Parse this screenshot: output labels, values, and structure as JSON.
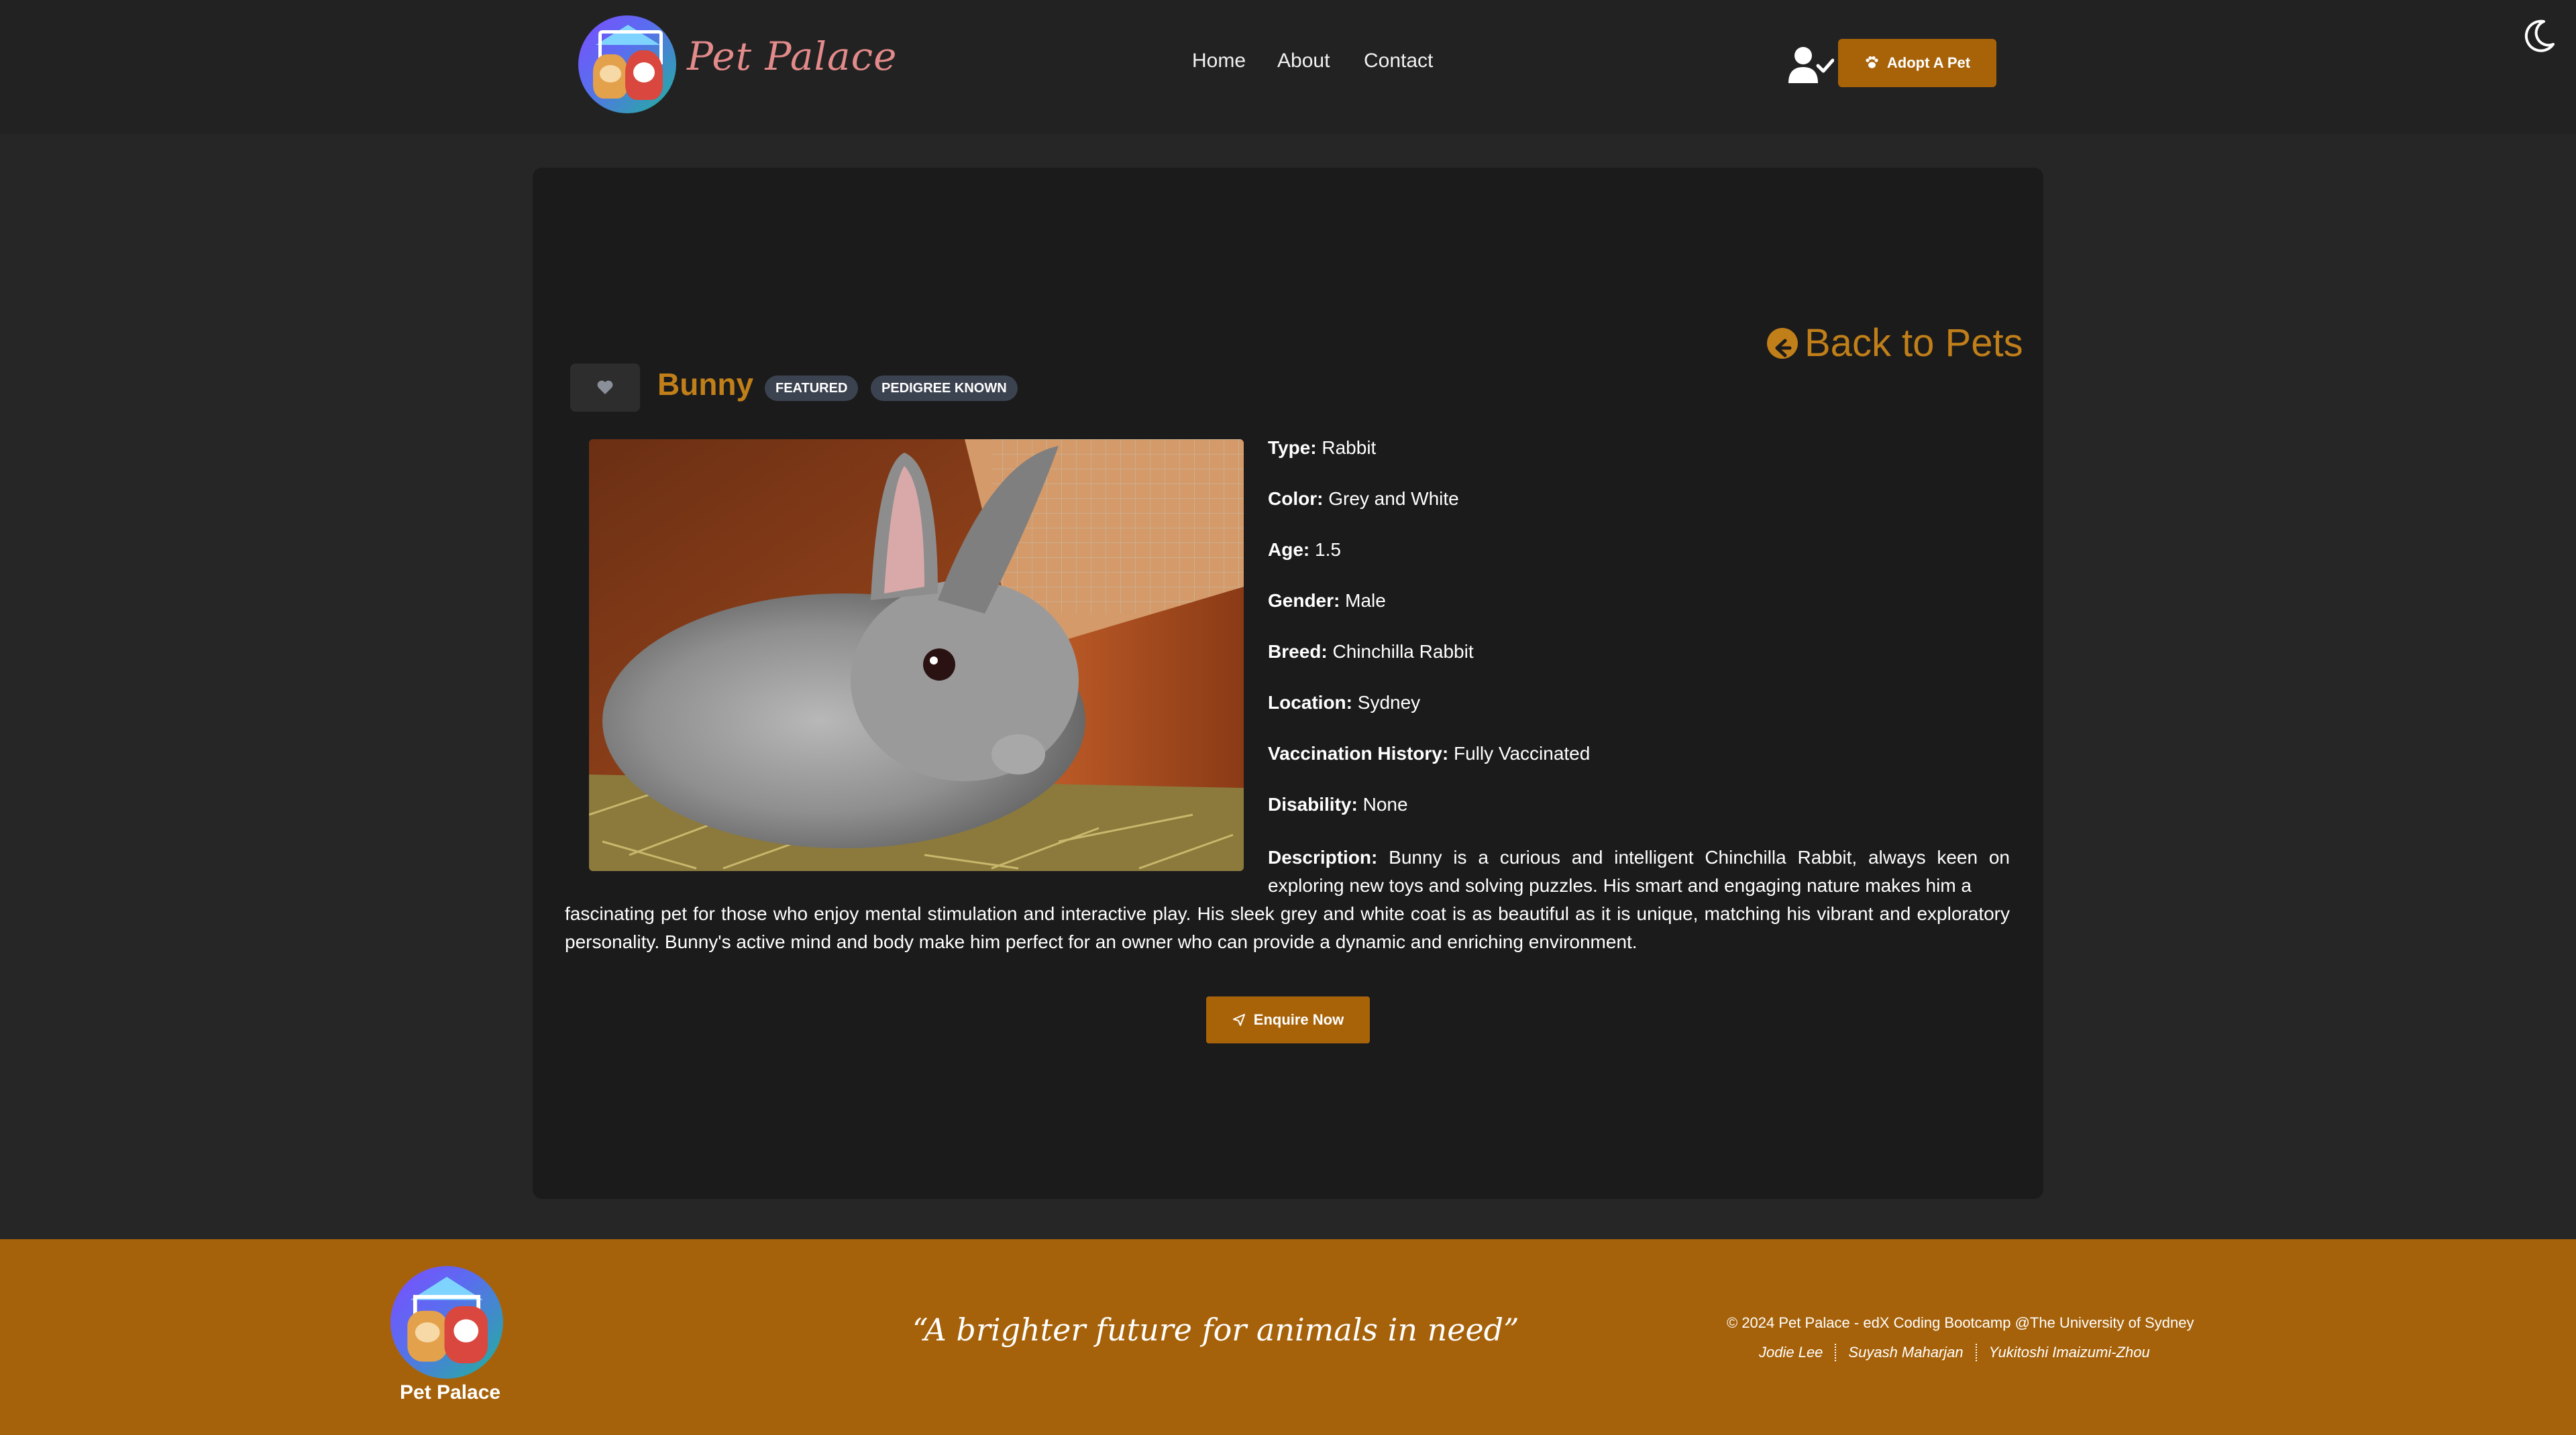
{
  "header": {
    "brand": "Pet Palace",
    "nav": [
      "Home",
      "About",
      "Contact"
    ],
    "adopt_button": "Adopt A Pet"
  },
  "pet": {
    "back_link": "Back to Pets",
    "name": "Bunny",
    "badges": [
      "FEATURED",
      "PEDIGREE KNOWN"
    ],
    "details": [
      {
        "label": "Type:",
        "value": "Rabbit"
      },
      {
        "label": "Color:",
        "value": "Grey and White"
      },
      {
        "label": "Age:",
        "value": "1.5"
      },
      {
        "label": "Gender:",
        "value": "Male"
      },
      {
        "label": "Breed:",
        "value": "Chinchilla Rabbit"
      },
      {
        "label": "Location:",
        "value": "Sydney"
      },
      {
        "label": "Vaccination History:",
        "value": "Fully Vaccinated"
      },
      {
        "label": "Disability:",
        "value": "None"
      }
    ],
    "description_label": "Description:",
    "description_part1": "Bunny is a curious and intelligent Chinchilla Rabbit, always keen on exploring new toys and solving puzzles. His smart and engaging nature makes him a",
    "description_part2": "fascinating pet for those who enjoy mental stimulation and interactive play. His sleek grey and white coat is as beautiful as it is unique, matching his vibrant and exploratory personality. Bunny's active mind and body make him perfect for an owner who can provide a dynamic and enriching environment.",
    "enquire_button": "Enquire Now"
  },
  "footer": {
    "brand": "Pet Palace",
    "slogan": "“A brighter future for animals in need”",
    "copyright": "© 2024 Pet Palace - edX Coding Bootcamp @The University of Sydney",
    "authors": [
      "Jodie Lee",
      "Suyash Maharjan",
      "Yukitoshi Imaizumi-Zhou"
    ]
  },
  "colors": {
    "accent": "#a86309",
    "title_accent": "#c17f19",
    "badge": "#3c4350",
    "background": "#262626",
    "card": "#1b1b1b"
  },
  "icons": [
    "moon-icon",
    "user-check-icon",
    "paw-icon",
    "arrow-left-circle-icon",
    "heart-icon",
    "send-icon"
  ]
}
